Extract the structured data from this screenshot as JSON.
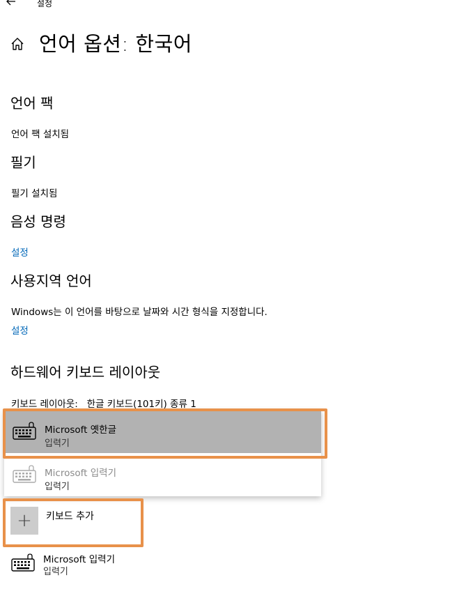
{
  "app": {
    "title": "설정"
  },
  "page": {
    "title": "언어 옵션: 한국어"
  },
  "sections": {
    "language_pack": {
      "heading": "언어 팩",
      "status": "언어 팩 설치됨"
    },
    "handwriting": {
      "heading": "필기",
      "status": "필기 설치됨"
    },
    "speech": {
      "heading": "음성 명령",
      "link": "설정"
    },
    "regional": {
      "heading": "사용지역 언어",
      "description": "Windows는 이 언어를 바탕으로 날짜와 시간 형식을 지정합니다.",
      "link": "설정"
    },
    "hardware_keyboard": {
      "heading": "하드웨어 키보드 레이아웃",
      "layout_label": "키보드 레이아웃:",
      "layout_value": "한글 키보드(101키) 종류 1"
    }
  },
  "dropdown": {
    "options": [
      {
        "name": "Microsoft 옛한글",
        "type": "입력기",
        "state": "selected"
      },
      {
        "name": "Microsoft 입력기",
        "type": "입력기",
        "state": "disabled"
      }
    ]
  },
  "keyboards": {
    "add_label": "키보드 추가",
    "installed": [
      {
        "name": "Microsoft 입력기",
        "type": "입력기"
      }
    ]
  },
  "colors": {
    "link": "#0067b8",
    "highlight": "#e8914a",
    "selected_bg": "#b2b2b2"
  },
  "icons": [
    "back-arrow-icon",
    "home-icon",
    "keyboard-icon",
    "plus-icon"
  ]
}
